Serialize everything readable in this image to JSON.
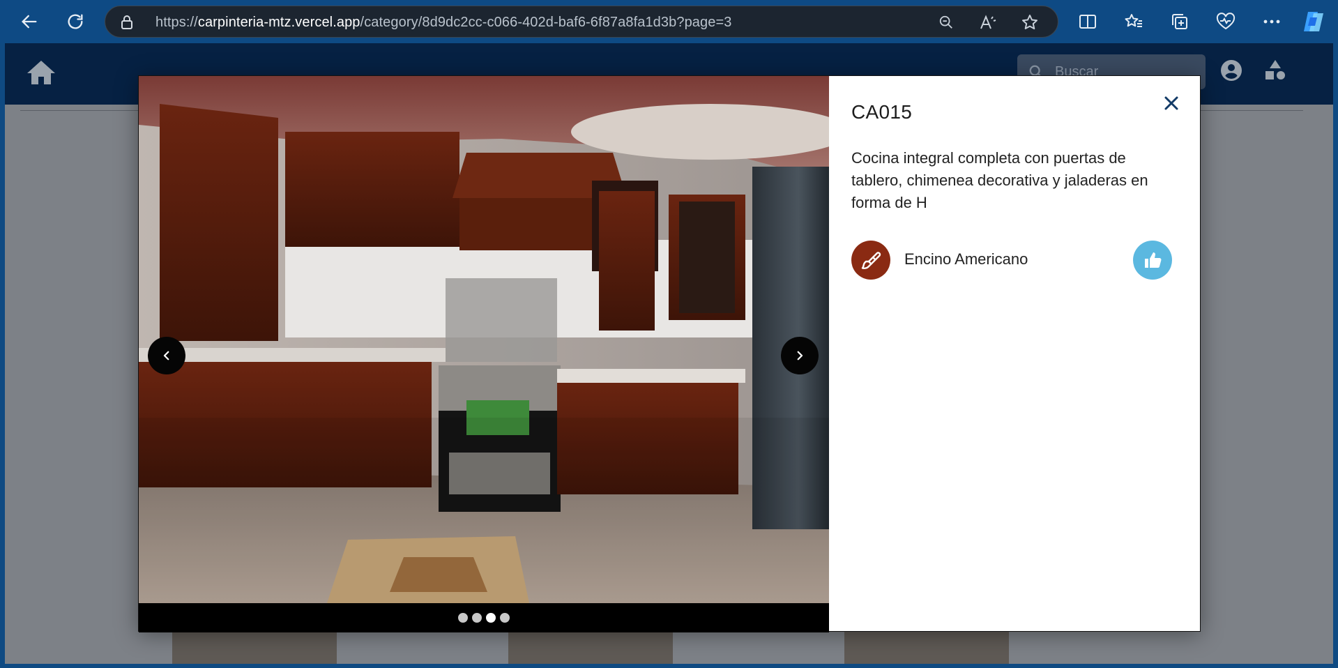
{
  "browser": {
    "url_scheme": "https://",
    "url_host": "carpinteria-mtz.vercel.app",
    "url_path": "/category/8d9dc2cc-c066-402d-baf6-6f87a8fa1d3b?page=3"
  },
  "app": {
    "search_placeholder": "Buscar"
  },
  "modal": {
    "product_code": "CA015",
    "description": "Cocina integral completa con puertas de tablero, chimenea decorativa y jaladeras en forma de H",
    "material": "Encino Americano",
    "gallery": {
      "image_count": 4,
      "active_index": 2
    }
  },
  "colors": {
    "browser_bar": "#0e4a84",
    "app_header": "#062143",
    "material_badge": "#8a2a12",
    "like_button": "#5bb8e0"
  }
}
